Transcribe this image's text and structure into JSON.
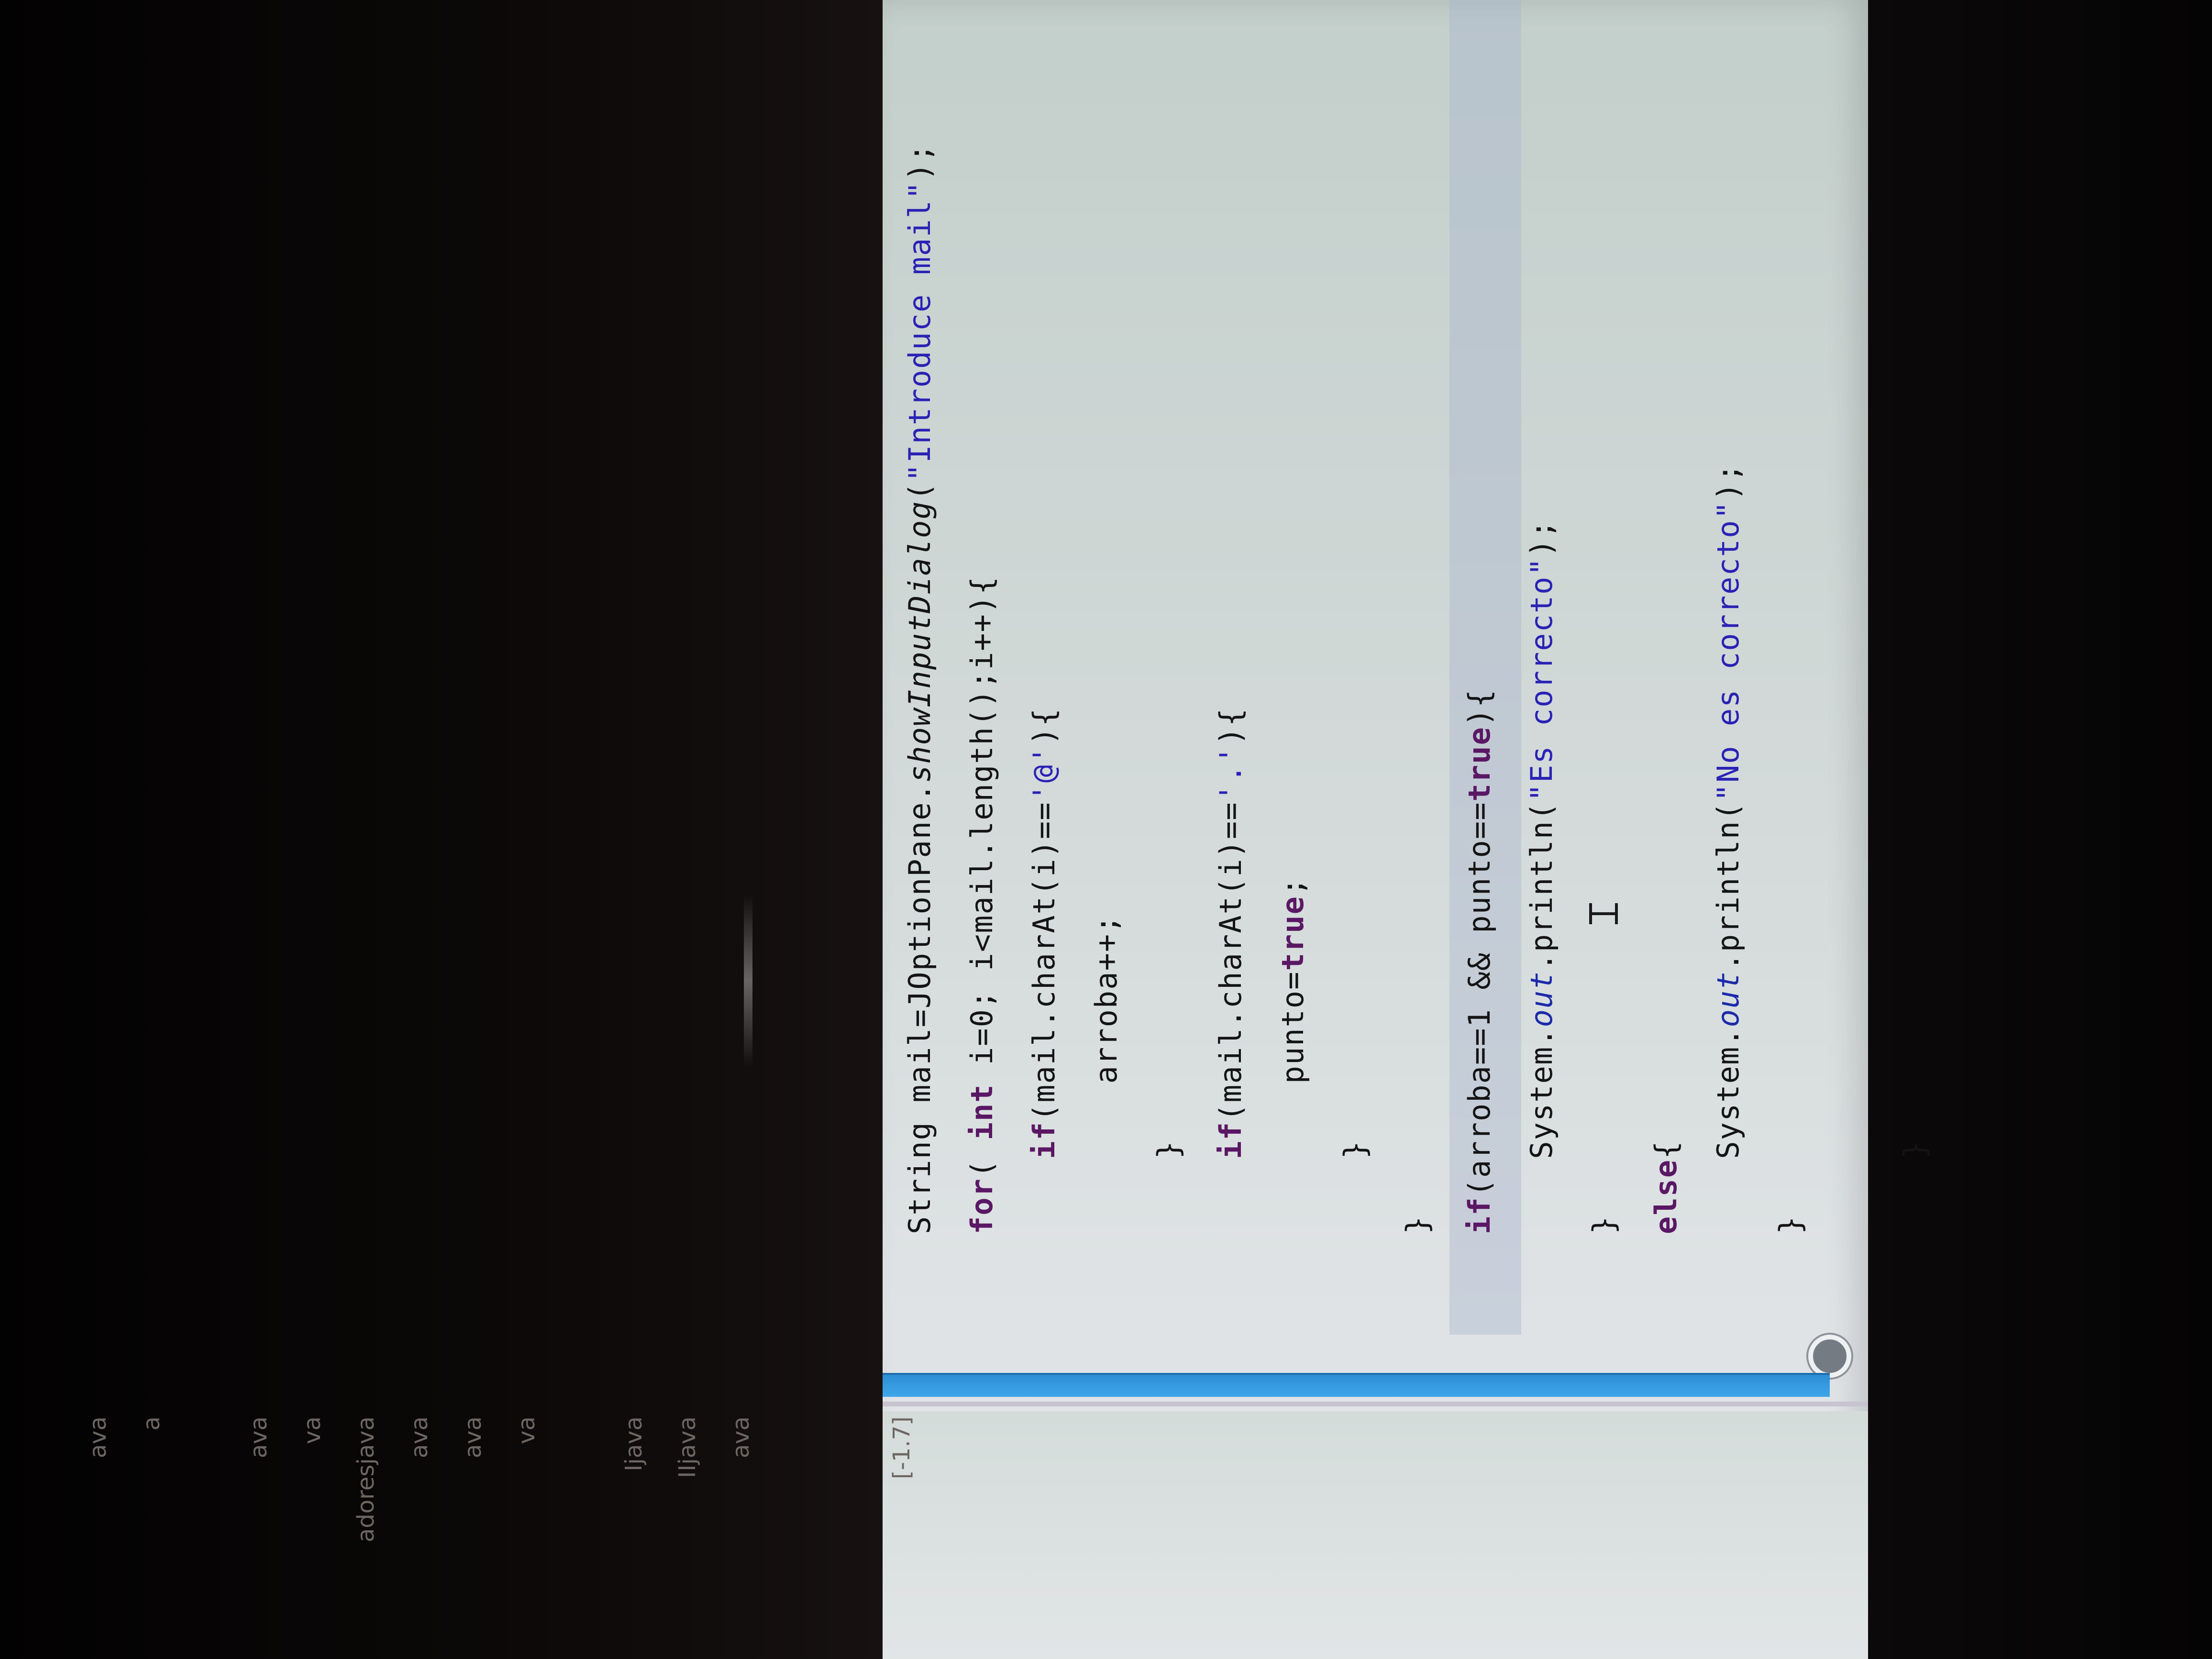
{
  "editor": {
    "code_lines": [
      [
        {
          "t": "String ",
          "c": "plain"
        },
        {
          "t": "mail",
          "c": "plain"
        },
        {
          "t": "=JOptionPane.",
          "c": "plain"
        },
        {
          "t": "showInputDialog",
          "c": "itl"
        },
        {
          "t": "(",
          "c": "plain"
        },
        {
          "t": "\"Introduce mail\"",
          "c": "str"
        },
        {
          "t": ");",
          "c": "plain"
        }
      ],
      [
        {
          "t": "for",
          "c": "kw"
        },
        {
          "t": "( ",
          "c": "plain"
        },
        {
          "t": "int",
          "c": "kw"
        },
        {
          "t": " i=0; i<mail.length();i++){",
          "c": "plain"
        }
      ],
      [
        {
          "t": "    ",
          "c": "plain"
        },
        {
          "t": "if",
          "c": "kw"
        },
        {
          "t": "(mail.charAt(i)==",
          "c": "plain"
        },
        {
          "t": "'@'",
          "c": "str"
        },
        {
          "t": "){",
          "c": "plain"
        }
      ],
      [
        {
          "t": "        arroba++;",
          "c": "plain"
        }
      ],
      [
        {
          "t": "    }",
          "c": "plain"
        }
      ],
      [
        {
          "t": "    ",
          "c": "plain"
        },
        {
          "t": "if",
          "c": "kw"
        },
        {
          "t": "(mail.charAt(i)==",
          "c": "plain"
        },
        {
          "t": "'.'",
          "c": "str"
        },
        {
          "t": "){",
          "c": "plain"
        }
      ],
      [
        {
          "t": "        punto=",
          "c": "plain"
        },
        {
          "t": "true",
          "c": "kw"
        },
        {
          "t": ";",
          "c": "plain"
        }
      ],
      [
        {
          "t": "    }",
          "c": "plain"
        }
      ],
      [
        {
          "t": "}",
          "c": "plain"
        }
      ],
      [
        {
          "t": "if",
          "c": "kw"
        },
        {
          "t": "(arroba==1 && punto==",
          "c": "plain"
        },
        {
          "t": "true",
          "c": "kw"
        },
        {
          "t": "){",
          "c": "plain"
        }
      ],
      [
        {
          "t": "    System.",
          "c": "plain"
        },
        {
          "t": "out",
          "c": "fld"
        },
        {
          "t": ".println(",
          "c": "plain"
        },
        {
          "t": "\"Es correcto\"",
          "c": "str"
        },
        {
          "t": ");",
          "c": "plain"
        }
      ],
      [
        {
          "t": "}",
          "c": "plain"
        }
      ],
      [
        {
          "t": "else",
          "c": "kw"
        },
        {
          "t": "{",
          "c": "plain"
        }
      ],
      [
        {
          "t": "    System.",
          "c": "plain"
        },
        {
          "t": "out",
          "c": "fld"
        },
        {
          "t": ".println(",
          "c": "plain"
        },
        {
          "t": "\"No es correcto\"",
          "c": "str"
        },
        {
          "t": ");",
          "c": "plain"
        }
      ],
      [
        {
          "t": "}",
          "c": "plain"
        }
      ],
      [
        {
          "t": "",
          "c": "plain"
        }
      ],
      [
        {
          "t": "    }",
          "c": "plain"
        }
      ]
    ]
  },
  "files": {
    "items": [
      "ava",
      "a",
      "",
      "ava",
      "va",
      "adoresjava",
      "ava",
      "ava",
      "va",
      "",
      "Ijava",
      "IIjava",
      "ava",
      "",
      "",
      "[-1.7]"
    ]
  },
  "colors": {
    "divider_blue": "#3fa6ea",
    "screen_bg": "#d2d9d8",
    "keyword": "#5a1763",
    "string": "#2a21b5"
  },
  "icons": {
    "gutter": "breakpoint-circle-icon",
    "cursor": "text-cursor-icon"
  }
}
